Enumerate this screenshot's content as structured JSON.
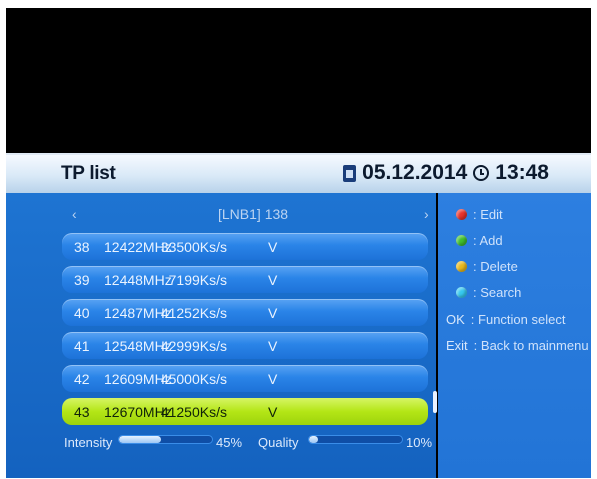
{
  "header": {
    "title": "TP list",
    "date": "05.12.2014",
    "time": "13:48"
  },
  "list": {
    "lnb_label": "[LNB1] 138",
    "nav_left": "‹",
    "nav_right": "›",
    "rows": [
      {
        "num": "38",
        "freq": "12422MHz",
        "symbol_rate": "33500Ks/s",
        "pol": "V",
        "selected": false
      },
      {
        "num": "39",
        "freq": "12448MHz",
        "symbol_rate": "7199Ks/s",
        "pol": "V",
        "selected": false
      },
      {
        "num": "40",
        "freq": "12487MHz",
        "symbol_rate": "41252Ks/s",
        "pol": "V",
        "selected": false
      },
      {
        "num": "41",
        "freq": "12548MHz",
        "symbol_rate": "42999Ks/s",
        "pol": "V",
        "selected": false
      },
      {
        "num": "42",
        "freq": "12609MHz",
        "symbol_rate": "45000Ks/s",
        "pol": "V",
        "selected": false
      },
      {
        "num": "43",
        "freq": "12670MHz",
        "symbol_rate": "41250Ks/s",
        "pol": "V",
        "selected": true
      }
    ]
  },
  "signal": {
    "intensity_label": "Intensity",
    "intensity_value": "45%",
    "intensity_level": 0.45,
    "quality_label": "Quality",
    "quality_value": "10%",
    "quality_level": 0.1
  },
  "legend": {
    "edit": {
      "icon": "red-button-icon",
      "color": "#e8322a",
      "label": ": Edit"
    },
    "add": {
      "icon": "green-button-icon",
      "color": "#3fbf2c",
      "label": ": Add"
    },
    "delete": {
      "icon": "yellow-button-icon",
      "color": "#e8b81c",
      "label": ": Delete"
    },
    "search": {
      "icon": "blue-button-icon",
      "color": "#35c8ef",
      "label": ": Search"
    },
    "ok": {
      "key": "OK",
      "label": ": Function select"
    },
    "exit": {
      "key": "Exit",
      "label": ": Back to mainmenu"
    }
  }
}
